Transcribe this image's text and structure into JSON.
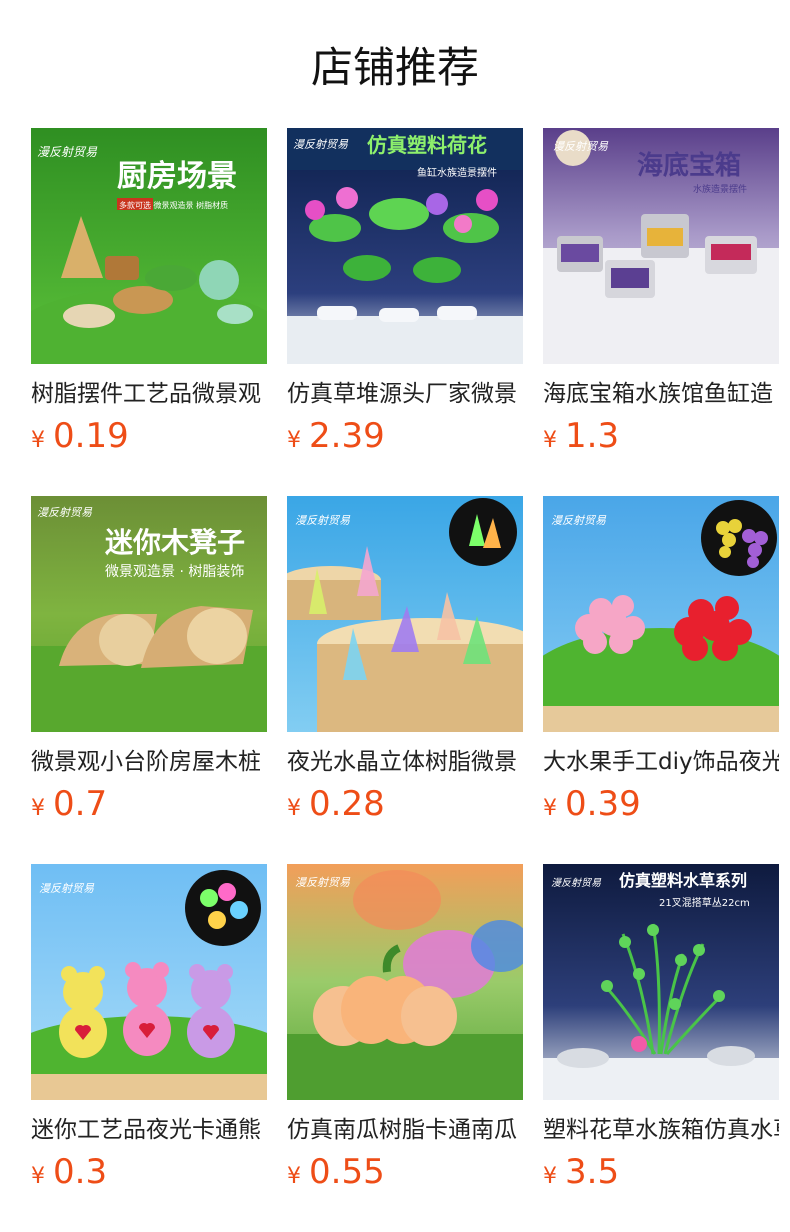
{
  "page_title": "店铺推荐",
  "products": [
    {
      "name": "树脂摆件工艺品微景观",
      "currency": "¥",
      "price": "0.19",
      "banner": "厨房场景",
      "sub": "多款可选 微景观造景 树脂材质",
      "brand": "漫反射贸易",
      "theme": "kitchen"
    },
    {
      "name": "仿真草堆源头厂家微景",
      "currency": "¥",
      "price": "2.39",
      "banner": "仿真塑料荷花",
      "sub": "鱼缸水族造景摆件",
      "brand": "漫反射贸易",
      "theme": "lotus"
    },
    {
      "name": "海底宝箱水族馆鱼缸造",
      "currency": "¥",
      "price": "1.3",
      "banner": "海底宝箱",
      "sub": "水族造景摆件",
      "brand": "漫反射贸易",
      "theme": "chest"
    },
    {
      "name": "微景观小台阶房屋木桩",
      "currency": "¥",
      "price": "0.7",
      "banner": "迷你木凳子",
      "sub": "微景观造景 · 树脂装饰",
      "brand": "漫反射贸易",
      "theme": "stool"
    },
    {
      "name": "夜光水晶立体树脂微景",
      "currency": "¥",
      "price": "0.28",
      "banner": "",
      "sub": "",
      "brand": "漫反射贸易",
      "theme": "crystal"
    },
    {
      "name": "大水果手工diy饰品夜光",
      "currency": "¥",
      "price": "0.39",
      "banner": "",
      "sub": "",
      "brand": "漫反射贸易",
      "theme": "grape"
    },
    {
      "name": "迷你工艺品夜光卡通熊",
      "currency": "¥",
      "price": "0.3",
      "banner": "",
      "sub": "",
      "brand": "漫反射贸易",
      "theme": "bear"
    },
    {
      "name": "仿真南瓜树脂卡通南瓜",
      "currency": "¥",
      "price": "0.55",
      "banner": "",
      "sub": "",
      "brand": "漫反射贸易",
      "theme": "pumpkin"
    },
    {
      "name": "塑料花草水族箱仿真水草",
      "currency": "¥",
      "price": "3.5",
      "banner": "仿真塑料水草系列",
      "sub": "21叉混搭草丛22cm",
      "brand": "漫反射贸易",
      "theme": "waterplant"
    }
  ]
}
